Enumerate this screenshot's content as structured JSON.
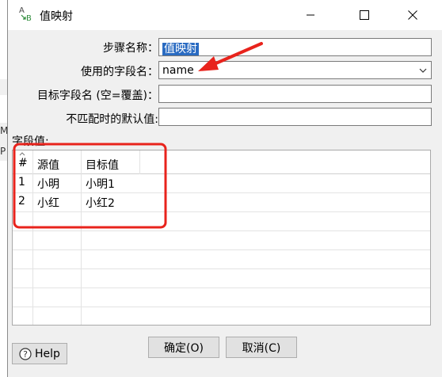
{
  "window": {
    "title": "值映射"
  },
  "background": {
    "fragment_1": "M",
    "fragment_2": "P"
  },
  "form": {
    "step_name_label": "步骤名称：",
    "step_name_value": "值映射",
    "field_name_label": "使用的字段名：",
    "field_name_value": "name",
    "target_field_label": "目标字段名 (空=覆盖)：",
    "target_field_value": "",
    "default_value_label": "不匹配时的默认值:",
    "default_value_value": ""
  },
  "table": {
    "section_label": "字段值:",
    "headers": [
      "#",
      "源值",
      "目标值"
    ],
    "rows": [
      [
        "1",
        "小明",
        "小明1"
      ],
      [
        "2",
        "小红",
        "小红2"
      ]
    ]
  },
  "buttons": {
    "help": "Help",
    "ok": "确定(O)",
    "cancel": "取消(C)"
  },
  "annotations": {
    "box_color": "#e8231c",
    "arrow_color": "#e8231c"
  },
  "icons": {
    "app": "ab-value-mapper-icon",
    "minimize": "minimize-icon",
    "maximize": "maximize-icon",
    "close": "close-icon",
    "dropdown": "chevron-down-icon",
    "help": "question-circle-icon",
    "sort": "sort-caret-icon"
  }
}
